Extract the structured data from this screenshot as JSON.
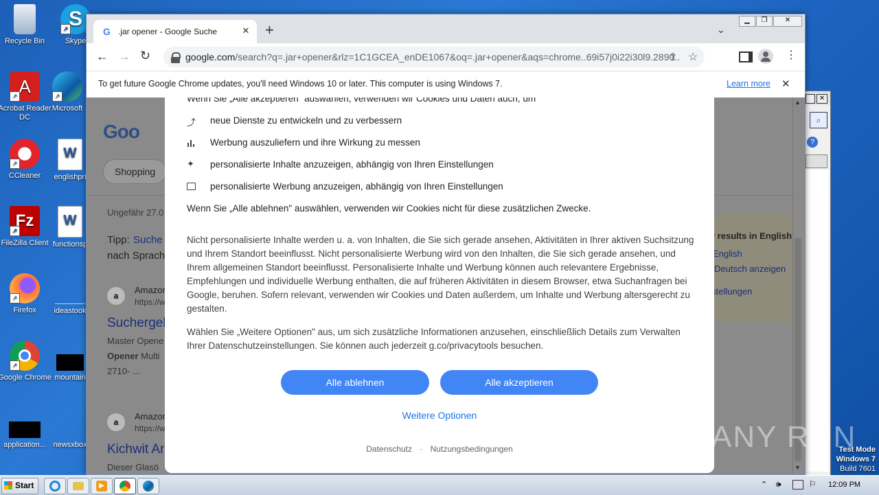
{
  "desktop": {
    "icons": [
      {
        "label": "Recycle Bin"
      },
      {
        "label": "Skype"
      },
      {
        "label": "Acrobat Reader DC"
      },
      {
        "label": "Microsoft"
      },
      {
        "label": "CCleaner"
      },
      {
        "label": "englishpri"
      },
      {
        "label": "FileZilla Client"
      },
      {
        "label": "functionsp"
      },
      {
        "label": "Firefox"
      },
      {
        "label": "ideastook"
      },
      {
        "label": "Google Chrome"
      },
      {
        "label": "mountain"
      },
      {
        "label": "application..."
      },
      {
        "label": "newsxbox"
      }
    ],
    "watermark": {
      "mode": "Test Mode",
      "os": "Windows 7",
      "build": "Build 7601"
    },
    "anyrun": "ANY RUN"
  },
  "chrome": {
    "tab_title": ".jar opener - Google Suche",
    "new_tab": "+",
    "url_host": "google.com",
    "url_path": "/search?q=.jar+opener&rlz=1C1GCEA_enDE1067&oq=.jar+opener&aqs=chrome..69i57j0i22i30l9.2890...",
    "infobar_text": "To get future Google Chrome updates, you'll need Windows 10 or later. This computer is using Windows 7.",
    "infobar_link": "Learn more"
  },
  "background_page": {
    "chip": "Shopping",
    "results_count": "Ungefähr 27.0",
    "tipp_label": "Tipp:",
    "tipp_link": "Suche",
    "tipp_rest": "nach Sprach",
    "right_title": "r results in English",
    "right_link1": "English",
    "right_link2": "Deutsch anzeigen",
    "right_link3": "stellungen",
    "result1": {
      "site": "Amazon",
      "url": "https://w",
      "title": "Suchergel",
      "snippet1": "Master Opene",
      "snippet2_bold": "Opener",
      "snippet2": " Multi",
      "snippet3": "2710- ..."
    },
    "result2": {
      "site": "Amazon",
      "url": "https://w",
      "title": "Kichwit Ar",
      "snippet1": "Dieser Glasö"
    }
  },
  "consent": {
    "intro": "Wenn Sie „Alle akzeptieren\" auswählen, verwenden wir Cookies und Daten auch, um",
    "bullets": [
      {
        "icon": "trend-icon",
        "text": "neue Dienste zu entwickeln und zu verbessern"
      },
      {
        "icon": "bar-chart-icon",
        "text": "Werbung auszuliefern und ihre Wirkung zu messen"
      },
      {
        "icon": "sparkle-icon",
        "text": "personalisierte Inhalte anzuzeigen, abhängig von Ihren Einstellungen"
      },
      {
        "icon": "ad-icon",
        "text": "personalisierte Werbung anzuzeigen, abhängig von Ihren Einstellungen"
      }
    ],
    "reject_note": "Wenn Sie „Alle ablehnen\" auswählen, verwenden wir Cookies nicht für diese zusätzlichen Zwecke.",
    "para1": "Nicht personalisierte Inhalte werden u. a. von Inhalten, die Sie sich gerade ansehen, Aktivitäten in Ihrer aktiven Suchsitzung und Ihrem Standort beeinflusst. Nicht personalisierte Werbung wird von den Inhalten, die Sie sich gerade ansehen, und Ihrem allgemeinen Standort beeinflusst. Personalisierte Inhalte und Werbung können auch relevantere Ergebnisse, Empfehlungen und individuelle Werbung enthalten, die auf früheren Aktivitäten in diesem Browser, etwa Suchanfragen bei Google, beruhen. Sofern relevant, verwenden wir Cookies und Daten außerdem, um Inhalte und Werbung altersgerecht zu gestalten.",
    "para2": "Wählen Sie „Weitere Optionen\" aus, um sich zusätzliche Informationen anzusehen, einschließlich Details zum Verwalten Ihrer Datenschutzeinstellungen. Sie können auch jederzeit g.co/privacytools besuchen.",
    "reject_btn": "Alle ablehnen",
    "accept_btn": "Alle akzeptieren",
    "more_options": "Weitere Optionen",
    "privacy": "Datenschutz",
    "dot": "·",
    "terms": "Nutzungsbedingungen"
  },
  "taskbar": {
    "start": "Start",
    "clock": "12:09 PM"
  }
}
